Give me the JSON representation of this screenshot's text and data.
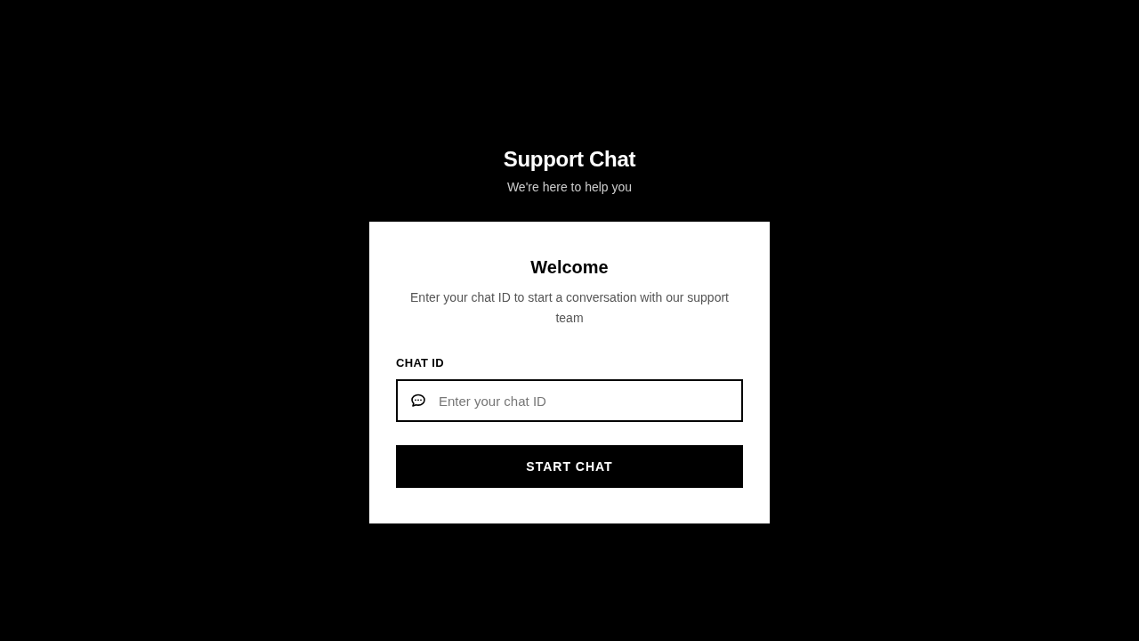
{
  "header": {
    "title": "Support Chat",
    "subtitle": "We're here to help you"
  },
  "card": {
    "title": "Welcome",
    "description": "Enter your chat ID to start a conversation with our support team",
    "field": {
      "label": "CHAT ID",
      "placeholder": "Enter your chat ID"
    },
    "button": "START CHAT"
  }
}
